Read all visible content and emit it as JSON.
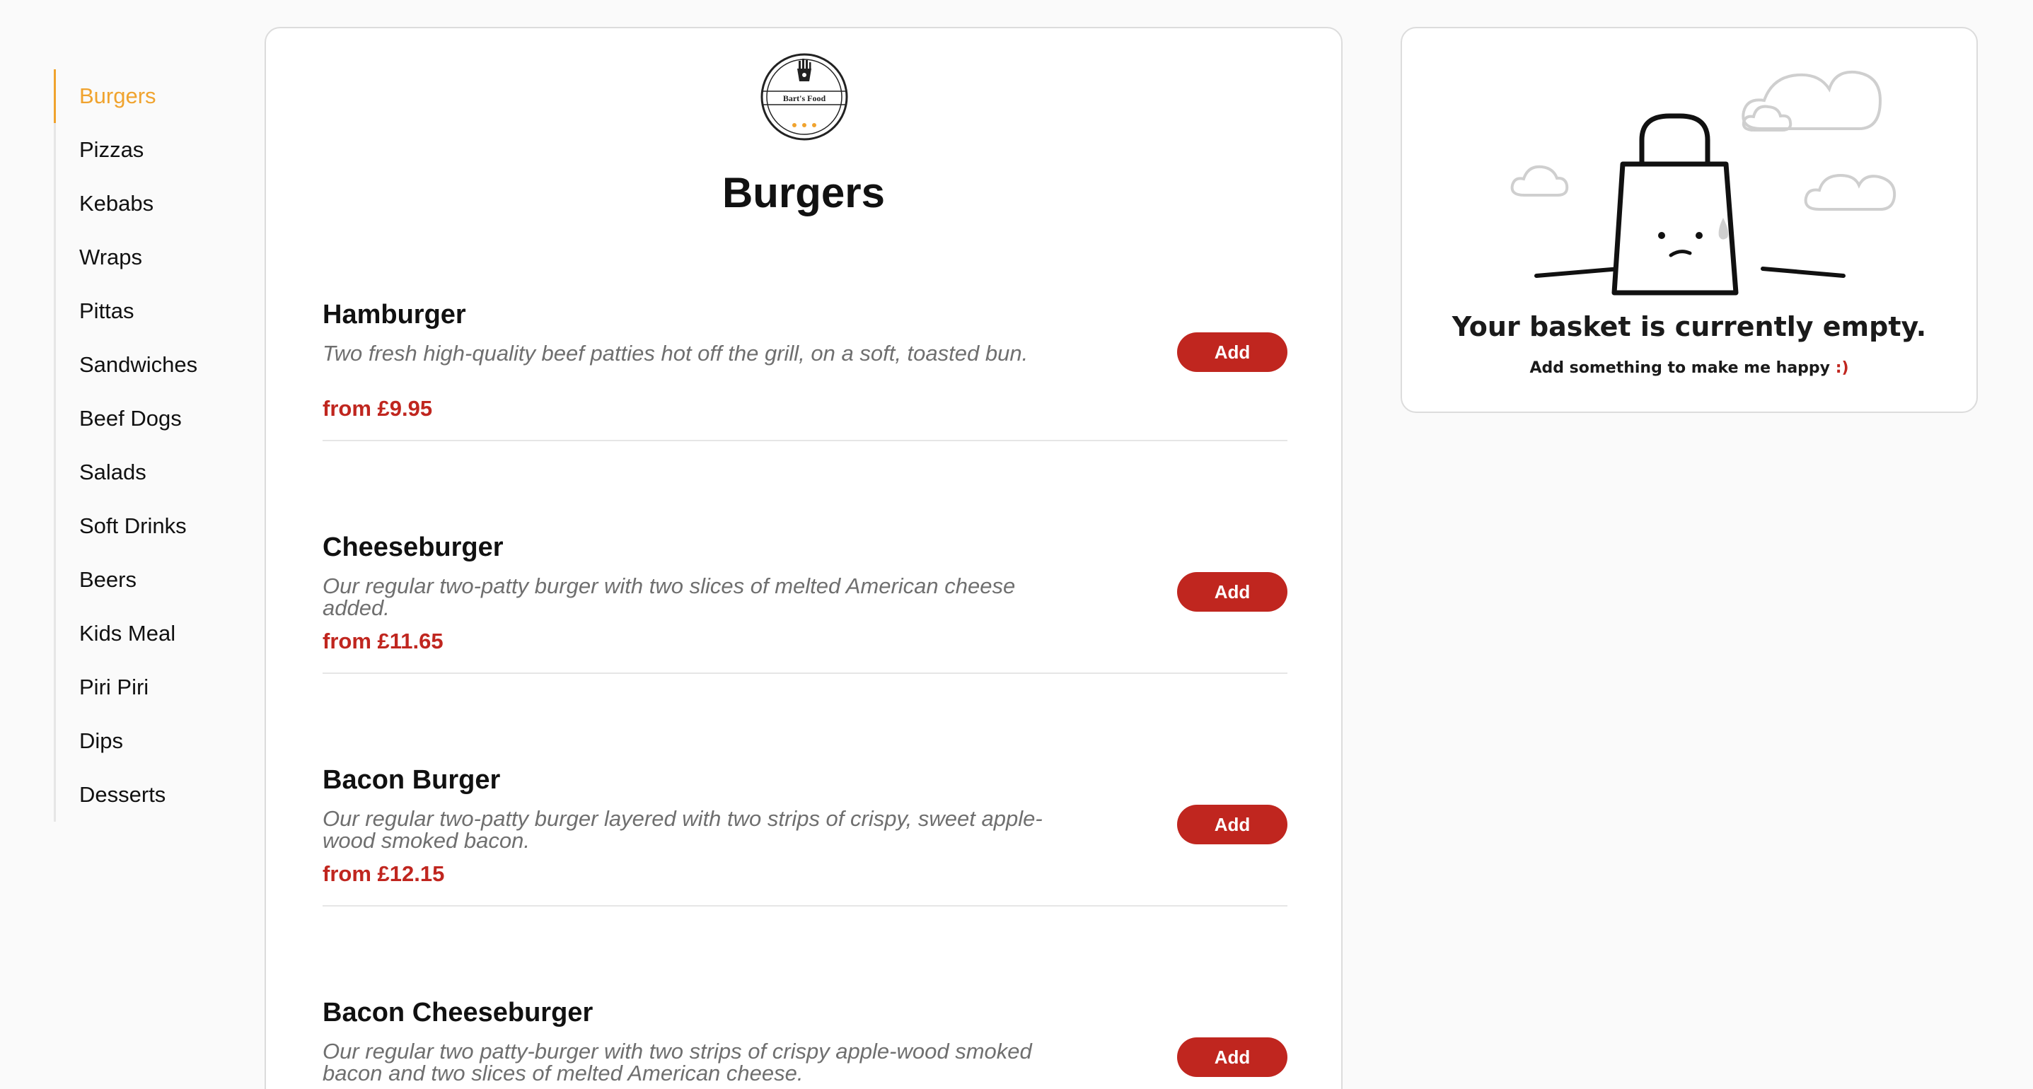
{
  "sidebar": {
    "categories": [
      {
        "label": "Burgers",
        "active": true
      },
      {
        "label": "Pizzas"
      },
      {
        "label": "Kebabs"
      },
      {
        "label": "Wraps"
      },
      {
        "label": "Pittas"
      },
      {
        "label": "Sandwiches"
      },
      {
        "label": "Beef Dogs"
      },
      {
        "label": "Salads"
      },
      {
        "label": "Soft Drinks"
      },
      {
        "label": "Beers"
      },
      {
        "label": "Kids Meal"
      },
      {
        "label": "Piri Piri"
      },
      {
        "label": "Dips"
      },
      {
        "label": "Desserts"
      }
    ]
  },
  "menu": {
    "logo_text": "Bart's Food",
    "logo_icon": "fries-icon",
    "section_title": "Burgers",
    "products": [
      {
        "name": "Hamburger",
        "description": "Two fresh high-quality beef patties hot off the grill, on a soft, toasted bun.",
        "price": "from £9.95",
        "add_label": "Add"
      },
      {
        "name": "Cheeseburger",
        "description": "Our regular two-patty burger with two slices of melted American cheese added.",
        "price": "from £11.65",
        "add_label": "Add"
      },
      {
        "name": "Bacon Burger",
        "description": "Our regular two-patty burger layered with two strips of crispy, sweet apple-wood smoked bacon.",
        "price": "from £12.15",
        "add_label": "Add"
      },
      {
        "name": "Bacon Cheeseburger",
        "description": "Our regular two patty-burger with two strips of crispy apple-wood smoked bacon and two slices of melted American cheese.",
        "price": "",
        "add_label": "Add"
      }
    ]
  },
  "basket": {
    "title": "Your basket is currently empty.",
    "subtitle": "Add something to make me happy",
    "smiley": ":)",
    "illustration": "sad-shopping-bag-icon"
  },
  "colors": {
    "accent": "#f0a32e",
    "brand_red": "#c0261f",
    "description_gray": "#6f6f6f",
    "panel_border": "#dcdcdc",
    "background": "#fafafa"
  }
}
